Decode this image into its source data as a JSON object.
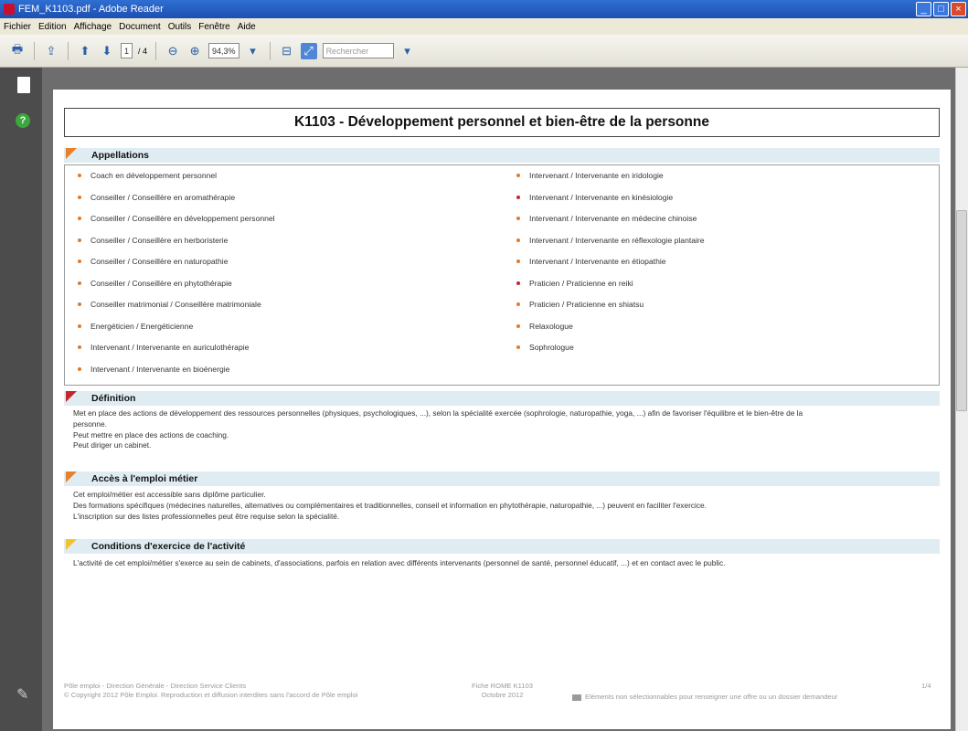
{
  "window": {
    "title": "FEM_K1103.pdf - Adobe Reader",
    "controls": [
      "_",
      "□",
      "×"
    ]
  },
  "menu": [
    "Fichier",
    "Edition",
    "Affichage",
    "Document",
    "Outils",
    "Fenêtre",
    "Aide"
  ],
  "toolbar": {
    "page_current": "1",
    "page_total": "/ 4",
    "zoom": "94,3%",
    "search_placeholder": "Rechercher"
  },
  "document": {
    "title": "K1103 - Développement personnel et bien-être de la personne",
    "sections": {
      "appellations": {
        "heading": "Appellations",
        "left": [
          "Coach en développement personnel",
          "Conseiller / Conseillère en aromathérapie",
          "Conseiller / Conseillère en développement personnel",
          "Conseiller / Conseillère en herboristerie",
          "Conseiller / Conseillère en naturopathie",
          "Conseiller / Conseillère en phytothérapie",
          "Conseiller matrimonial / Conseillère matrimoniale",
          "Energéticien / Energéticienne",
          "Intervenant / Intervenante en auriculothérapie",
          "Intervenant / Intervenante en bioénergie"
        ],
        "right": [
          "Intervenant / Intervenante en iridologie",
          "Intervenant / Intervenante en kinésiologie",
          "Intervenant / Intervenante en médecine chinoise",
          "Intervenant / Intervenante en réflexologie plantaire",
          "Intervenant / Intervenante en étiopathie",
          "Praticien / Praticienne en reiki",
          "Praticien / Praticienne en shiatsu",
          "Relaxologue",
          "Sophrologue"
        ],
        "bullet_colors_left": [
          "#e07a2a",
          "#e07a2a",
          "#e07a2a",
          "#e07a2a",
          "#e07a2a",
          "#e07a2a",
          "#e07a2a",
          "#e07a2a",
          "#e07a2a",
          "#e07a2a"
        ],
        "bullet_colors_right": [
          "#e07a2a",
          "#c3262b",
          "#e07a2a",
          "#e07a2a",
          "#e07a2a",
          "#c3262b",
          "#e07a2a",
          "#e07a2a",
          "#e07a2a"
        ]
      },
      "definition": {
        "heading": "Définition",
        "lines": [
          "Met en place des actions de développement des ressources personnelles (physiques, psychologiques, ...), selon la spécialité exercée (sophrologie, naturopathie, yoga, ...) afin de favoriser l'équilibre et le bien-être de la",
          "personne.",
          "Peut mettre en place des actions de coaching.",
          "Peut diriger un cabinet."
        ]
      },
      "acces": {
        "heading": "Accès à l'emploi métier",
        "lines": [
          "Cet emploi/métier est accessible sans diplôme particulier.",
          "Des formations spécifiques (médecines naturelles, alternatives ou complémentaires et traditionnelles, conseil et information en phytothérapie, naturopathie, ...) peuvent en faciliter l'exercice.",
          "L'inscription sur des listes professionnelles peut être requise selon la spécialité."
        ]
      },
      "conditions": {
        "heading": "Conditions d'exercice de l'activité",
        "lines": [
          "L'activité de cet emploi/métier s'exerce au sein de cabinets, d'associations, parfois en relation avec différents intervenants (personnel de santé, personnel éducatif, ...) et en contact avec le public."
        ]
      }
    },
    "footer": {
      "left_1": "Pôle emploi - Direction Générale - Direction Service Clients",
      "left_2": "© Copyright 2012 Pôle Emploi. Reproduction et diffusion interdites sans l'accord de Pôle emploi",
      "center_1": "Fiche ROME K1103",
      "center_2": "Octobre 2012",
      "right_note": "Eléments non sélectionnables pour renseigner une offre ou un dossier demandeur",
      "page": "1/4"
    }
  }
}
